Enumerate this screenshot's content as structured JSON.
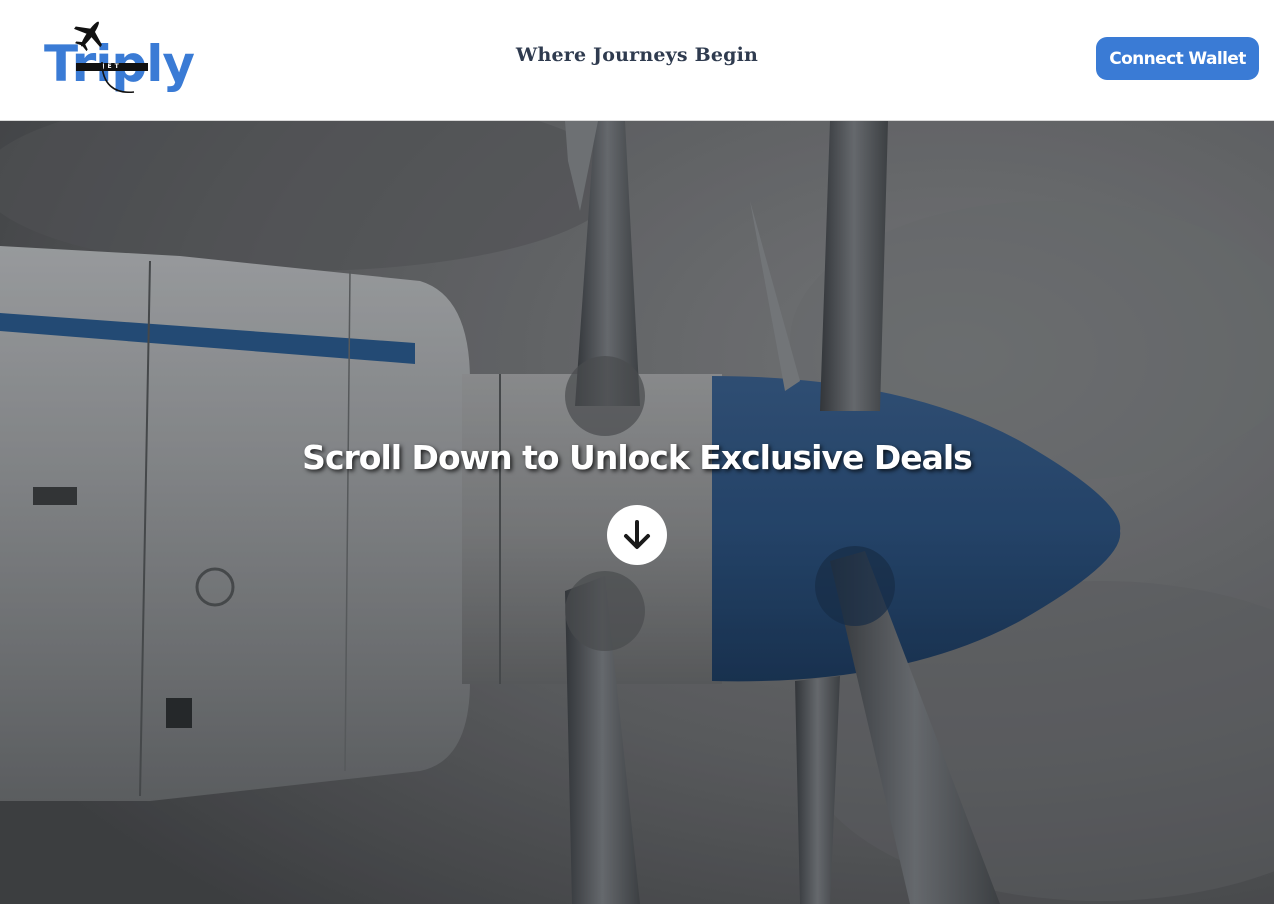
{
  "header": {
    "logo": {
      "word": "Triply",
      "band_text": "JET"
    },
    "tagline": "Where Journeys Begin",
    "connect_button_label": "Connect Wallet"
  },
  "hero": {
    "headline": "Scroll Down to Unlock Exclusive Deals",
    "scroll_icon": "arrow-down-circle-icon",
    "background_image": "propeller-aircraft-engine-photo"
  },
  "colors": {
    "accent": "#3a7bd5",
    "tagline": "#2f3b4f",
    "header_bg": "#ffffff"
  }
}
